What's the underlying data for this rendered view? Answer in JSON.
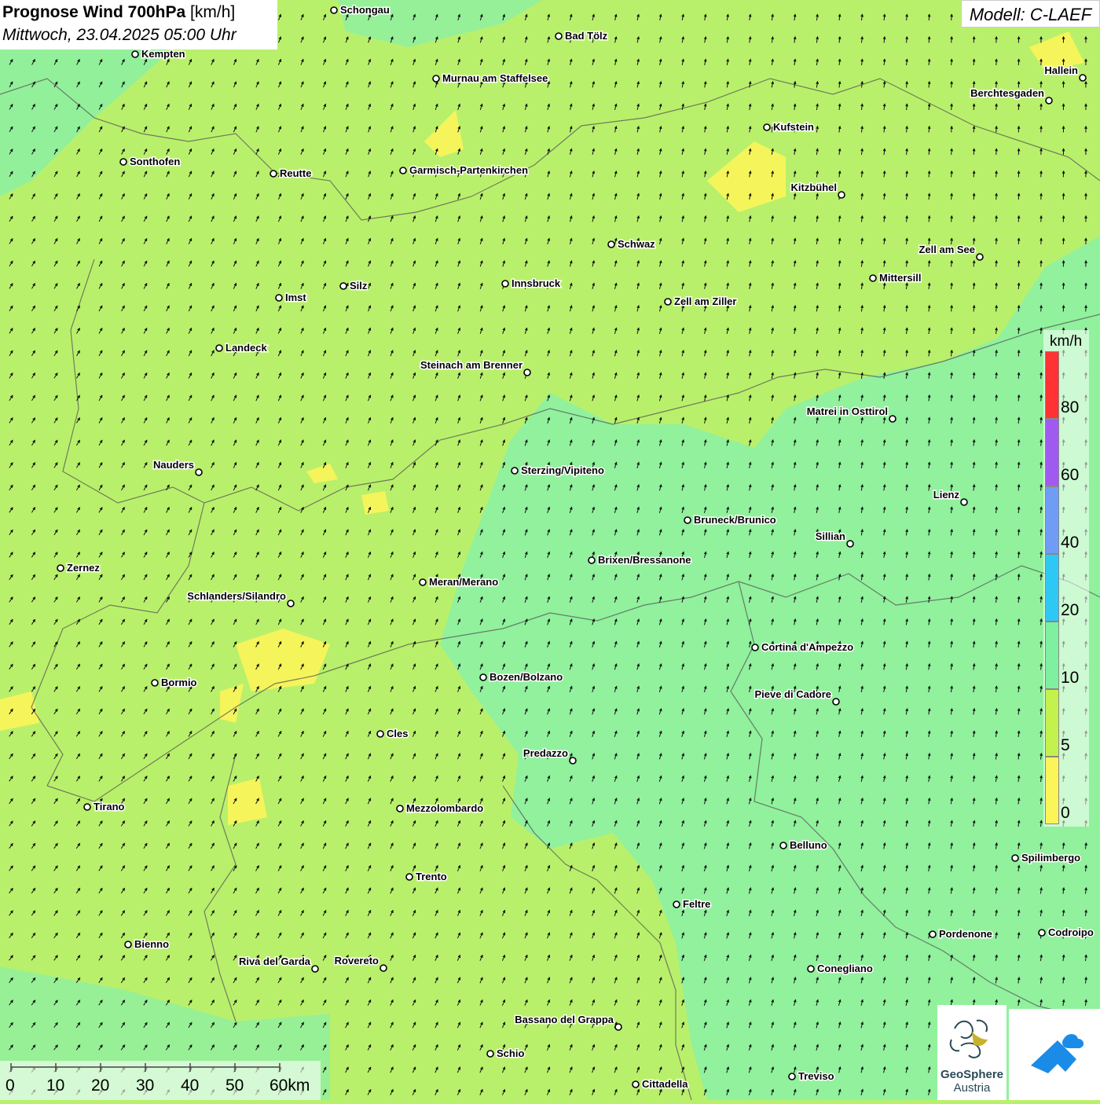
{
  "title": {
    "main": "Prognose Wind 700hPa",
    "unit": "[km/h]",
    "datetime": "Mittwoch, 23.04.2025 05:00 Uhr"
  },
  "model": "Modell: C-LAEF",
  "legend": {
    "unit": "km/h",
    "ticks": [
      "80",
      "60",
      "40",
      "20",
      "10",
      "5",
      "0"
    ],
    "colors": [
      "#ff3333",
      "#a05af0",
      "#6f9cf5",
      "#2ec8f5",
      "#7ef0a0",
      "#c4f24c",
      "#fcf55a"
    ]
  },
  "scale": {
    "labels": [
      "0",
      "10",
      "20",
      "30",
      "40",
      "50",
      "60km"
    ]
  },
  "cities": [
    {
      "name": "Schongau"
    },
    {
      "name": "Bad Tölz"
    },
    {
      "name": "Kempten"
    },
    {
      "name": "Murnau am Staffelsee"
    },
    {
      "name": "Hallein"
    },
    {
      "name": "Berchtesgaden"
    },
    {
      "name": "Kufstein"
    },
    {
      "name": "Sonthofen"
    },
    {
      "name": "Reutte"
    },
    {
      "name": "Garmisch-Partenkirchen"
    },
    {
      "name": "Kitzbühel"
    },
    {
      "name": "Schwaz"
    },
    {
      "name": "Zell am See"
    },
    {
      "name": "Mittersill"
    },
    {
      "name": "Innsbruck"
    },
    {
      "name": "Silz"
    },
    {
      "name": "Imst"
    },
    {
      "name": "Zell am Ziller"
    },
    {
      "name": "Landeck"
    },
    {
      "name": "Steinach am Brenner"
    },
    {
      "name": "Matrei in Osttirol"
    },
    {
      "name": "Nauders"
    },
    {
      "name": "Sterzing/Vipiteno"
    },
    {
      "name": "Lienz"
    },
    {
      "name": "Bruneck/Brunico"
    },
    {
      "name": "Sillian"
    },
    {
      "name": "Brixen/Bressanone"
    },
    {
      "name": "Zernez"
    },
    {
      "name": "Meran/Merano"
    },
    {
      "name": "Schlanders/Silandro"
    },
    {
      "name": "Cortina d'Ampezzo"
    },
    {
      "name": "Bozen/Bolzano"
    },
    {
      "name": "Bormio"
    },
    {
      "name": "Pieve di Cadore"
    },
    {
      "name": "Cles"
    },
    {
      "name": "Predazzo"
    },
    {
      "name": "Tirano"
    },
    {
      "name": "Mezzolombardo"
    },
    {
      "name": "Belluno"
    },
    {
      "name": "Spilimbergo"
    },
    {
      "name": "Trento"
    },
    {
      "name": "Feltre"
    },
    {
      "name": "Pordenone"
    },
    {
      "name": "Codroipo"
    },
    {
      "name": "Bienno"
    },
    {
      "name": "Riva del Garda"
    },
    {
      "name": "Rovereto"
    },
    {
      "name": "Conegliano"
    },
    {
      "name": "Bassano del Grappa"
    },
    {
      "name": "Schio"
    },
    {
      "name": "Treviso"
    },
    {
      "name": "Cittadella"
    }
  ],
  "logos": {
    "geosphere_line1": "GeoSphere",
    "geosphere_line2": "Austria"
  },
  "colors": {
    "zone_0_5": "#fcf55a",
    "zone_5_10": "#b9f06b",
    "zone_10_20": "#8ef0a0",
    "border": "#555555",
    "arrow": "#111111",
    "app_logo": "#1a8ce8"
  }
}
